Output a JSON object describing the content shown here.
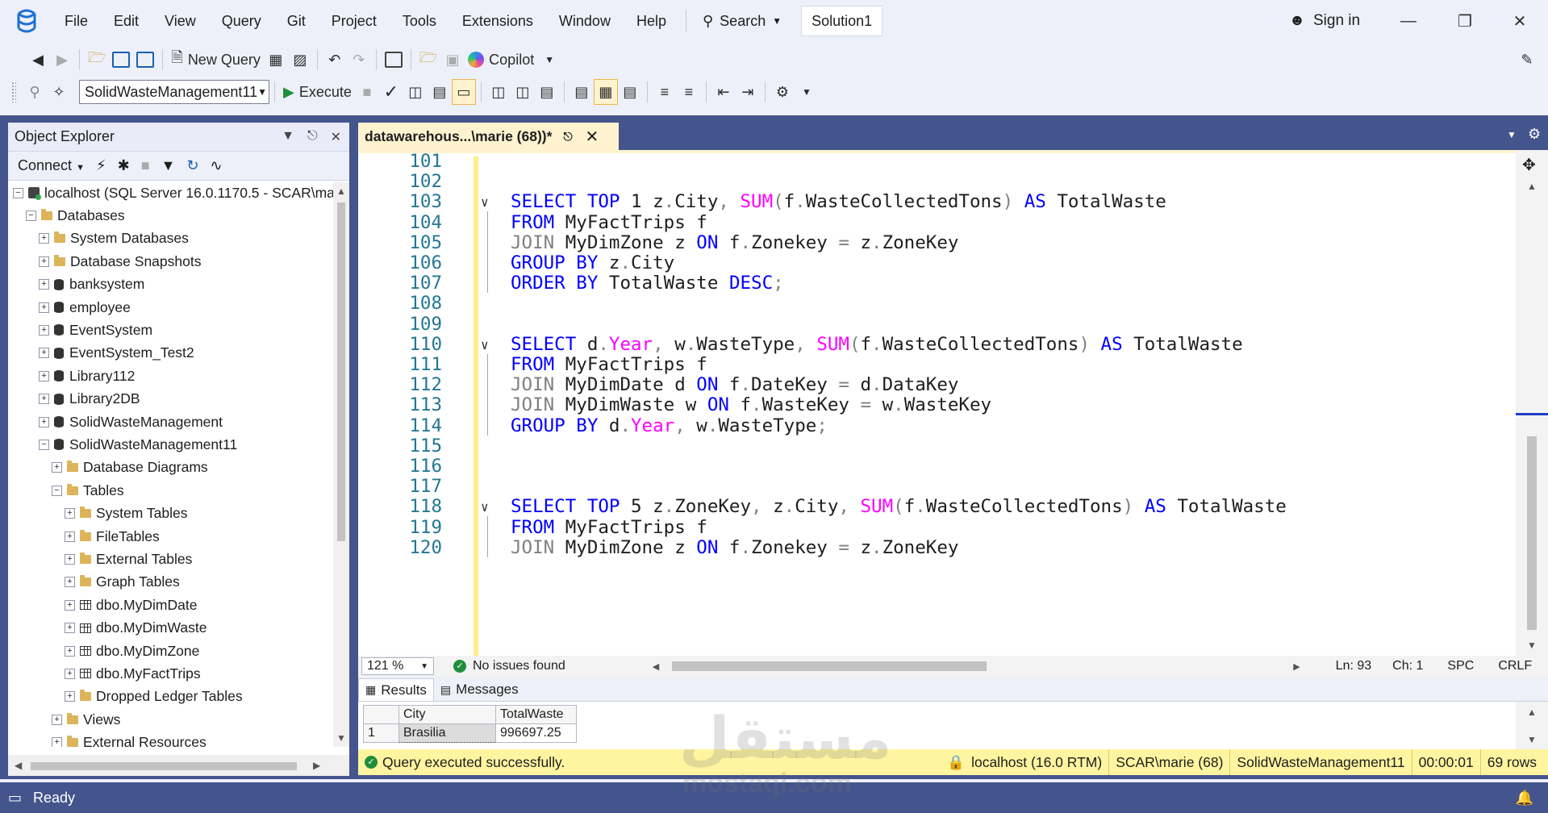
{
  "menu": [
    "File",
    "Edit",
    "View",
    "Query",
    "Git",
    "Project",
    "Tools",
    "Extensions",
    "Window",
    "Help"
  ],
  "search_label": "Search",
  "solution_name": "Solution1",
  "sign_in": "Sign in",
  "toolbar": {
    "new_query": "New Query",
    "copilot": "Copilot",
    "database": "SolidWasteManagement11",
    "execute": "Execute"
  },
  "object_explorer": {
    "title": "Object Explorer",
    "connect": "Connect",
    "tree": [
      {
        "label": "localhost (SQL Server 16.0.1170.5 - SCAR\\marie)",
        "level": 0,
        "icon": "server-icon",
        "exp": "−"
      },
      {
        "label": "Databases",
        "level": 1,
        "icon": "folder-icon",
        "exp": "−"
      },
      {
        "label": "System Databases",
        "level": 2,
        "icon": "folder-icon",
        "exp": "+"
      },
      {
        "label": "Database Snapshots",
        "level": 2,
        "icon": "folder-icon",
        "exp": "+"
      },
      {
        "label": "banksystem",
        "level": 2,
        "icon": "database-icon",
        "exp": "+"
      },
      {
        "label": "employee",
        "level": 2,
        "icon": "database-icon",
        "exp": "+"
      },
      {
        "label": "EventSystem",
        "level": 2,
        "icon": "database-icon",
        "exp": "+"
      },
      {
        "label": "EventSystem_Test2",
        "level": 2,
        "icon": "database-icon",
        "exp": "+"
      },
      {
        "label": "Library112",
        "level": 2,
        "icon": "database-icon",
        "exp": "+"
      },
      {
        "label": "Library2DB",
        "level": 2,
        "icon": "database-icon",
        "exp": "+"
      },
      {
        "label": "SolidWasteManagement",
        "level": 2,
        "icon": "database-icon",
        "exp": "+"
      },
      {
        "label": "SolidWasteManagement11",
        "level": 2,
        "icon": "database-icon",
        "exp": "−"
      },
      {
        "label": "Database Diagrams",
        "level": 3,
        "icon": "folder-icon",
        "exp": "+"
      },
      {
        "label": "Tables",
        "level": 3,
        "icon": "folder-icon",
        "exp": "−"
      },
      {
        "label": "System Tables",
        "level": 4,
        "icon": "folder-icon",
        "exp": "+"
      },
      {
        "label": "FileTables",
        "level": 4,
        "icon": "folder-icon",
        "exp": "+"
      },
      {
        "label": "External Tables",
        "level": 4,
        "icon": "folder-icon",
        "exp": "+"
      },
      {
        "label": "Graph Tables",
        "level": 4,
        "icon": "folder-icon",
        "exp": "+"
      },
      {
        "label": "dbo.MyDimDate",
        "level": 4,
        "icon": "table-icon",
        "exp": "+"
      },
      {
        "label": "dbo.MyDimWaste",
        "level": 4,
        "icon": "table-icon",
        "exp": "+"
      },
      {
        "label": "dbo.MyDimZone",
        "level": 4,
        "icon": "table-icon",
        "exp": "+"
      },
      {
        "label": "dbo.MyFactTrips",
        "level": 4,
        "icon": "table-icon",
        "exp": "+"
      },
      {
        "label": "Dropped Ledger Tables",
        "level": 4,
        "icon": "folder-icon",
        "exp": "+"
      },
      {
        "label": "Views",
        "level": 3,
        "icon": "folder-icon",
        "exp": "+"
      },
      {
        "label": "External Resources",
        "level": 3,
        "icon": "folder-icon",
        "exp": "+"
      }
    ]
  },
  "editor": {
    "tab_title": "datawarehous...\\marie (68))*",
    "lines": [
      {
        "n": "101",
        "fold": false,
        "tokens": []
      },
      {
        "n": "102",
        "fold": false,
        "tokens": []
      },
      {
        "n": "103",
        "fold": true,
        "tokens": [
          [
            "kw",
            "SELECT"
          ],
          [
            "t",
            " "
          ],
          [
            "kw",
            "TOP"
          ],
          [
            "t",
            " 1 z"
          ],
          [
            "op",
            "."
          ],
          [
            "t",
            "City"
          ],
          [
            "op",
            ","
          ],
          [
            "t",
            " "
          ],
          [
            "fn",
            "SUM"
          ],
          [
            "op",
            "("
          ],
          [
            "t",
            "f"
          ],
          [
            "op",
            "."
          ],
          [
            "t",
            "WasteCollectedTons"
          ],
          [
            "op",
            ")"
          ],
          [
            "t",
            " "
          ],
          [
            "kw",
            "AS"
          ],
          [
            "t",
            " TotalWaste"
          ]
        ]
      },
      {
        "n": "104",
        "fold": false,
        "tokens": [
          [
            "kw",
            "FROM"
          ],
          [
            "t",
            " MyFactTrips f"
          ]
        ]
      },
      {
        "n": "105",
        "fold": false,
        "tokens": [
          [
            "op",
            "JOIN"
          ],
          [
            "t",
            " MyDimZone z "
          ],
          [
            "kw",
            "ON"
          ],
          [
            "t",
            " f"
          ],
          [
            "op",
            "."
          ],
          [
            "t",
            "Zonekey "
          ],
          [
            "op",
            "="
          ],
          [
            "t",
            " z"
          ],
          [
            "op",
            "."
          ],
          [
            "t",
            "ZoneKey"
          ]
        ]
      },
      {
        "n": "106",
        "fold": false,
        "tokens": [
          [
            "kw",
            "GROUP"
          ],
          [
            "t",
            " "
          ],
          [
            "kw",
            "BY"
          ],
          [
            "t",
            " z"
          ],
          [
            "op",
            "."
          ],
          [
            "t",
            "City"
          ]
        ]
      },
      {
        "n": "107",
        "fold": false,
        "tokens": [
          [
            "kw",
            "ORDER"
          ],
          [
            "t",
            " "
          ],
          [
            "kw",
            "BY"
          ],
          [
            "t",
            " TotalWaste "
          ],
          [
            "kw",
            "DESC"
          ],
          [
            "op",
            ";"
          ]
        ]
      },
      {
        "n": "108",
        "fold": false,
        "tokens": []
      },
      {
        "n": "109",
        "fold": false,
        "tokens": []
      },
      {
        "n": "110",
        "fold": true,
        "tokens": [
          [
            "kw",
            "SELECT"
          ],
          [
            "t",
            " d"
          ],
          [
            "op",
            "."
          ],
          [
            "fn",
            "Year"
          ],
          [
            "op",
            ","
          ],
          [
            "t",
            " w"
          ],
          [
            "op",
            "."
          ],
          [
            "t",
            "WasteType"
          ],
          [
            "op",
            ","
          ],
          [
            "t",
            " "
          ],
          [
            "fn",
            "SUM"
          ],
          [
            "op",
            "("
          ],
          [
            "t",
            "f"
          ],
          [
            "op",
            "."
          ],
          [
            "t",
            "WasteCollectedTons"
          ],
          [
            "op",
            ")"
          ],
          [
            "t",
            " "
          ],
          [
            "kw",
            "AS"
          ],
          [
            "t",
            " TotalWaste"
          ]
        ]
      },
      {
        "n": "111",
        "fold": false,
        "tokens": [
          [
            "kw",
            "FROM"
          ],
          [
            "t",
            " MyFactTrips f"
          ]
        ]
      },
      {
        "n": "112",
        "fold": false,
        "tokens": [
          [
            "op",
            "JOIN"
          ],
          [
            "t",
            " MyDimDate d "
          ],
          [
            "kw",
            "ON"
          ],
          [
            "t",
            " f"
          ],
          [
            "op",
            "."
          ],
          [
            "t",
            "DateKey "
          ],
          [
            "op",
            "="
          ],
          [
            "t",
            " d"
          ],
          [
            "op",
            "."
          ],
          [
            "t",
            "DataKey"
          ]
        ]
      },
      {
        "n": "113",
        "fold": false,
        "tokens": [
          [
            "op",
            "JOIN"
          ],
          [
            "t",
            " MyDimWaste w "
          ],
          [
            "kw",
            "ON"
          ],
          [
            "t",
            " f"
          ],
          [
            "op",
            "."
          ],
          [
            "t",
            "WasteKey "
          ],
          [
            "op",
            "="
          ],
          [
            "t",
            " w"
          ],
          [
            "op",
            "."
          ],
          [
            "t",
            "WasteKey"
          ]
        ]
      },
      {
        "n": "114",
        "fold": false,
        "tokens": [
          [
            "kw",
            "GROUP"
          ],
          [
            "t",
            " "
          ],
          [
            "kw",
            "BY"
          ],
          [
            "t",
            " d"
          ],
          [
            "op",
            "."
          ],
          [
            "fn",
            "Year"
          ],
          [
            "op",
            ","
          ],
          [
            "t",
            " w"
          ],
          [
            "op",
            "."
          ],
          [
            "t",
            "WasteType"
          ],
          [
            "op",
            ";"
          ]
        ]
      },
      {
        "n": "115",
        "fold": false,
        "tokens": []
      },
      {
        "n": "116",
        "fold": false,
        "tokens": []
      },
      {
        "n": "117",
        "fold": false,
        "tokens": []
      },
      {
        "n": "118",
        "fold": true,
        "tokens": [
          [
            "kw",
            "SELECT"
          ],
          [
            "t",
            " "
          ],
          [
            "kw",
            "TOP"
          ],
          [
            "t",
            " 5 z"
          ],
          [
            "op",
            "."
          ],
          [
            "t",
            "ZoneKey"
          ],
          [
            "op",
            ","
          ],
          [
            "t",
            " z"
          ],
          [
            "op",
            "."
          ],
          [
            "t",
            "City"
          ],
          [
            "op",
            ","
          ],
          [
            "t",
            " "
          ],
          [
            "fn",
            "SUM"
          ],
          [
            "op",
            "("
          ],
          [
            "t",
            "f"
          ],
          [
            "op",
            "."
          ],
          [
            "t",
            "WasteCollectedTons"
          ],
          [
            "op",
            ")"
          ],
          [
            "t",
            " "
          ],
          [
            "kw",
            "AS"
          ],
          [
            "t",
            " TotalWaste"
          ]
        ]
      },
      {
        "n": "119",
        "fold": false,
        "tokens": [
          [
            "kw",
            "FROM"
          ],
          [
            "t",
            " MyFactTrips f"
          ]
        ]
      },
      {
        "n": "120",
        "fold": false,
        "tokens": [
          [
            "op",
            "JOIN"
          ],
          [
            "t",
            " MyDimZone z "
          ],
          [
            "kw",
            "ON"
          ],
          [
            "t",
            " f"
          ],
          [
            "op",
            "."
          ],
          [
            "t",
            "Zonekey "
          ],
          [
            "op",
            "="
          ],
          [
            "t",
            " z"
          ],
          [
            "op",
            "."
          ],
          [
            "t",
            "ZoneKey"
          ]
        ]
      }
    ]
  },
  "editor_status": {
    "zoom": "121 %",
    "issues": "No issues found",
    "ln": "Ln: 93",
    "ch": "Ch: 1",
    "spc": "SPC",
    "crlf": "CRLF"
  },
  "results": {
    "tab_results": "Results",
    "tab_messages": "Messages",
    "columns": [
      "City",
      "TotalWaste"
    ],
    "rows": [
      {
        "n": "1",
        "cells": [
          "Brasilia",
          "996697.25"
        ]
      }
    ]
  },
  "query_status": {
    "message": "Query executed successfully.",
    "server": "localhost (16.0 RTM)",
    "user": "SCAR\\marie (68)",
    "database": "SolidWasteManagement11",
    "elapsed": "00:00:01",
    "rows": "69 rows"
  },
  "status": "Ready",
  "watermark": {
    "ar": "مستقل",
    "lat": "mostaql.com"
  }
}
